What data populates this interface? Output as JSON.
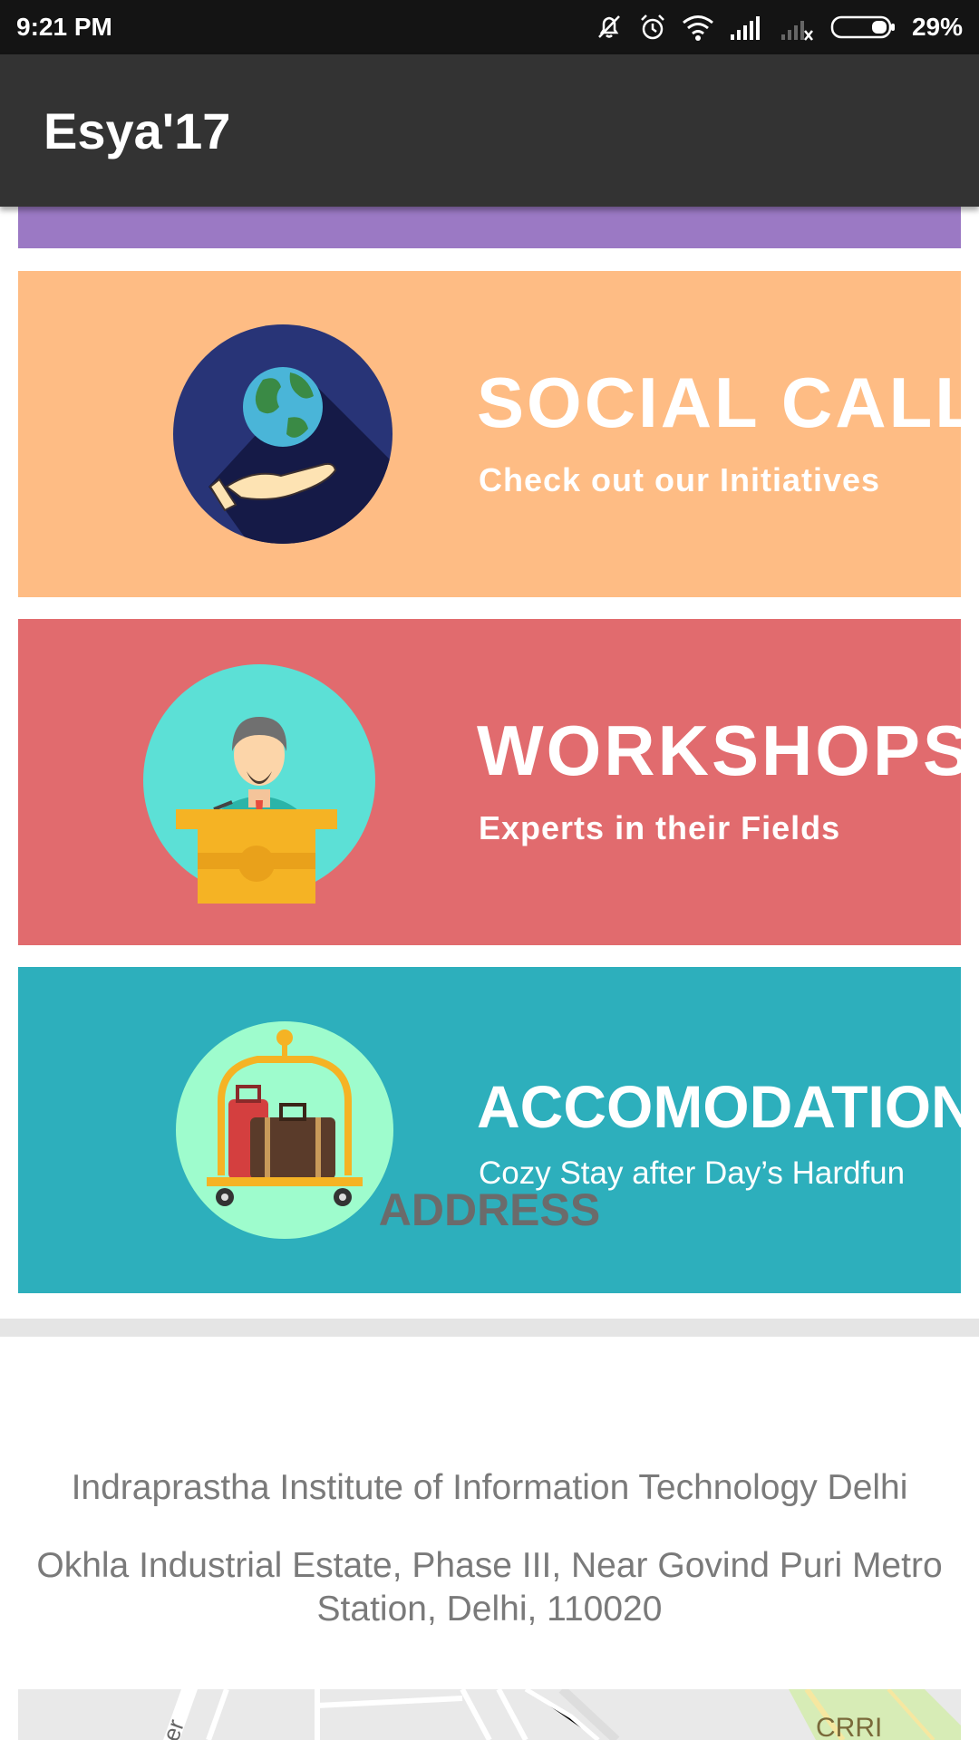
{
  "status_bar": {
    "time": "9:21 PM",
    "battery": "29%",
    "icons": [
      "notifications-off-icon",
      "alarm-icon",
      "wifi-icon",
      "signal-icon",
      "no-signal-icon",
      "battery-icon"
    ]
  },
  "app_bar": {
    "title": "Esya'17"
  },
  "banners": [
    {
      "title": "SOCIAL CALL",
      "subtitle": "Check out our Initiatives",
      "bg": "#febc84",
      "icon": "globe-hand-icon"
    },
    {
      "title": "WORKSHOPS",
      "subtitle": "Experts in their Fields",
      "bg": "#e16b6e",
      "icon": "speaker-podium-icon"
    },
    {
      "title": "ACCOMODATION",
      "subtitle": "Cozy Stay after Day’s Hardfun",
      "bg": "#2dafbc",
      "icon": "luggage-cart-icon"
    }
  ],
  "address": {
    "heading": "ADDRESS",
    "line1": "Indraprastha Institute of Information Technology Delhi",
    "line2": "Okhla Industrial Estate, Phase III, Near Govind Puri Metro Station, Delhi, 110020"
  },
  "map": {
    "label": "CRRI",
    "street": "er"
  }
}
